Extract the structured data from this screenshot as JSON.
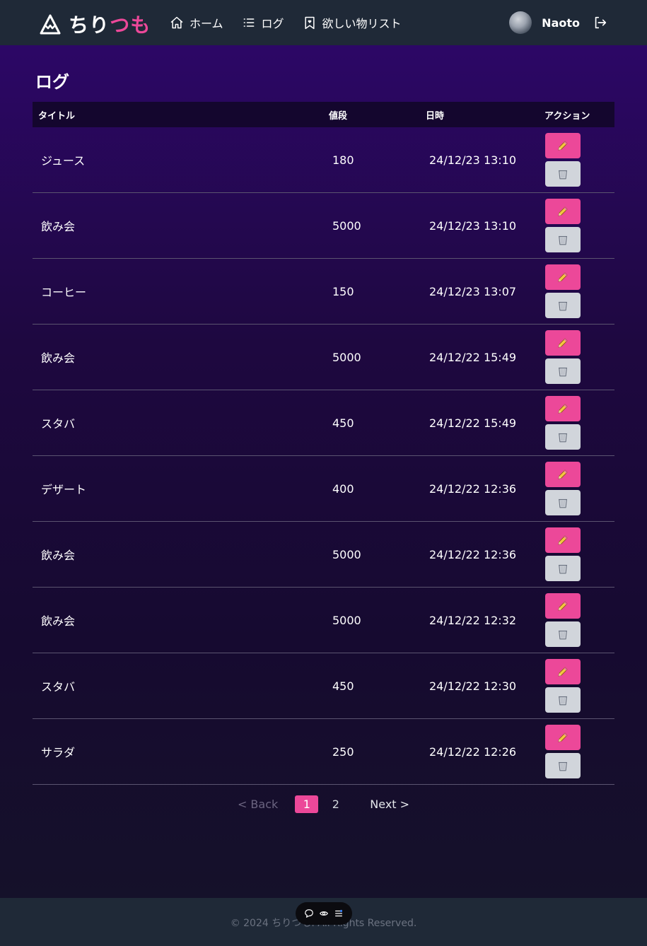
{
  "header": {
    "logo_part1": "ちり",
    "logo_part2": "つも",
    "nav": [
      {
        "label": "ホーム",
        "icon": "home-icon"
      },
      {
        "label": "ログ",
        "icon": "list-icon"
      },
      {
        "label": "欲しい物リスト",
        "icon": "bookmark-icon"
      }
    ],
    "user_name": "Naoto"
  },
  "page_title": "ログ",
  "table": {
    "headers": {
      "title": "タイトル",
      "price": "値段",
      "date": "日時",
      "actions": "アクション"
    },
    "rows": [
      {
        "title": "ジュース",
        "price": "180",
        "date": "24/12/23 13:10"
      },
      {
        "title": "飲み会",
        "price": "5000",
        "date": "24/12/23 13:10"
      },
      {
        "title": "コーヒー",
        "price": "150",
        "date": "24/12/23 13:07"
      },
      {
        "title": "飲み会",
        "price": "5000",
        "date": "24/12/22 15:49"
      },
      {
        "title": "スタバ",
        "price": "450",
        "date": "24/12/22 15:49"
      },
      {
        "title": "デザート",
        "price": "400",
        "date": "24/12/22 12:36"
      },
      {
        "title": "飲み会",
        "price": "5000",
        "date": "24/12/22 12:36"
      },
      {
        "title": "飲み会",
        "price": "5000",
        "date": "24/12/22 12:32"
      },
      {
        "title": "スタバ",
        "price": "450",
        "date": "24/12/22 12:30"
      },
      {
        "title": "サラダ",
        "price": "250",
        "date": "24/12/22 12:26"
      }
    ]
  },
  "pagination": {
    "back": "< Back",
    "pages": [
      "1",
      "2"
    ],
    "current": "1",
    "next": "Next >"
  },
  "footer": {
    "text": "© 2024 ちりつも. All Rights Reserved."
  },
  "colors": {
    "accent": "#ec4899",
    "header_bg": "#1f2937",
    "delete_bg": "#d1d5db"
  }
}
